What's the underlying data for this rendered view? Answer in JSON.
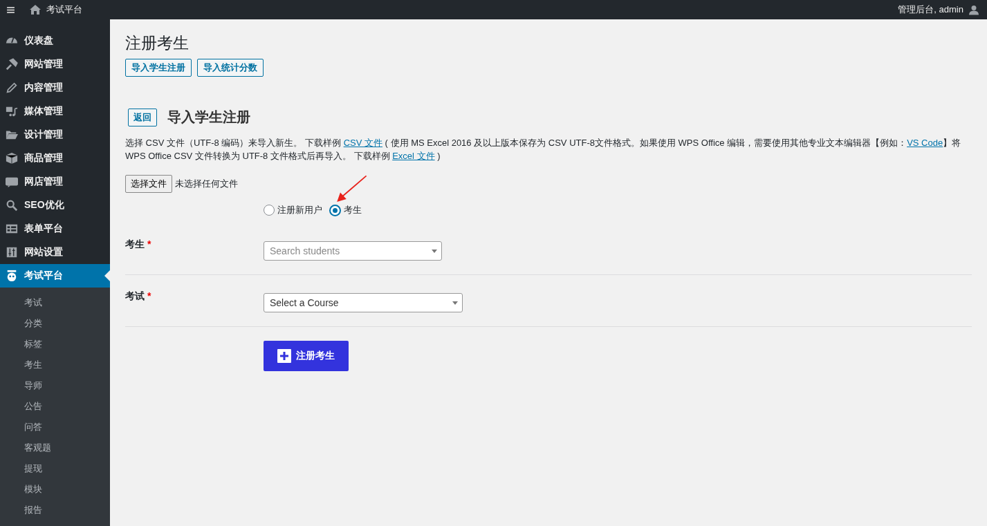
{
  "top_bar": {
    "site_title": "考试平台",
    "account": "管理后台, admin"
  },
  "sidebar": {
    "items": [
      {
        "label": "仪表盘",
        "selected": false
      },
      {
        "label": "网站管理",
        "selected": false
      },
      {
        "label": "内容管理",
        "selected": false
      },
      {
        "label": "媒体管理",
        "selected": false
      },
      {
        "label": "设计管理",
        "selected": false
      },
      {
        "label": "商品管理",
        "selected": false
      },
      {
        "label": "网店管理",
        "selected": false
      },
      {
        "label": "SEO优化",
        "selected": false
      },
      {
        "label": "表单平台",
        "selected": false
      },
      {
        "label": "网站设置",
        "selected": false
      },
      {
        "label": "考试平台",
        "selected": true
      }
    ],
    "submenu": [
      "考试",
      "分类",
      "标签",
      "考生",
      "导师",
      "公告",
      "问答",
      "客观题",
      "提现",
      "模块",
      "报告"
    ]
  },
  "page": {
    "title": "注册考生",
    "actions": [
      "导入学生注册",
      "导入统计分数"
    ]
  },
  "import": {
    "back": "返回",
    "heading": "导入学生注册",
    "description": [
      {
        "kind": "text",
        "text": "选择 CSV 文件（UTF-8 编码）来导入新生。 下载样例 "
      },
      {
        "kind": "link",
        "text": "CSV 文件"
      },
      {
        "kind": "text",
        "text": " ( 使用 MS Excel 2016 及以上版本保存为 CSV UTF-8文件格式。如果使用 WPS Office 编辑，需要使用其他专业文本编辑器【例如："
      },
      {
        "kind": "link",
        "text": "VS Code"
      },
      {
        "kind": "text",
        "text": "】将 WPS Office CSV 文件转换为 UTF-8 文件格式后再导入。 下载样例 "
      },
      {
        "kind": "link",
        "text": "Excel 文件"
      },
      {
        "kind": "text",
        "text": " )"
      }
    ],
    "file_button": "选择文件",
    "file_status": "未选择任何文件"
  },
  "radios": [
    {
      "label": "注册新用户",
      "selected": false
    },
    {
      "label": "考生",
      "selected": true
    }
  ],
  "form": {
    "fields": [
      {
        "label": "考生",
        "required_mark": "*",
        "placeholder": "Search students"
      },
      {
        "label": "考试",
        "required_mark": "*",
        "value": "Select a Course"
      }
    ],
    "submit": "注册考生"
  }
}
